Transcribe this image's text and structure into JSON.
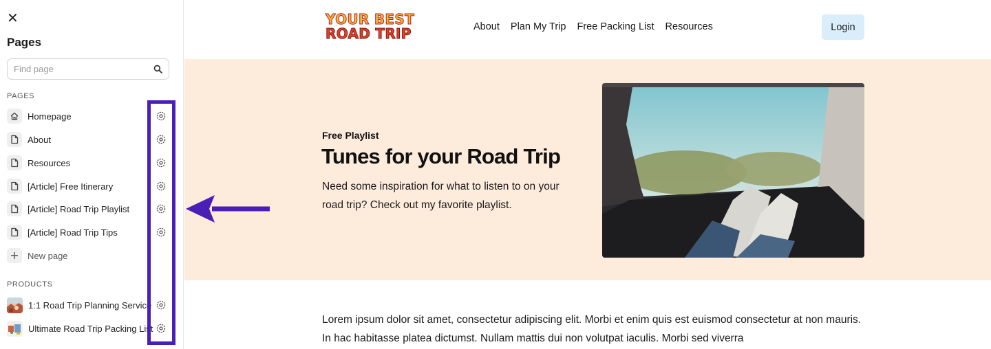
{
  "sidebar": {
    "close_glyph": "✕",
    "title": "Pages",
    "search": {
      "placeholder": "Find page",
      "value": ""
    },
    "pages_section_label": "PAGES",
    "pages": [
      {
        "label": "Homepage",
        "icon": "home-icon"
      },
      {
        "label": "About",
        "icon": "page-icon"
      },
      {
        "label": "Resources",
        "icon": "page-icon"
      },
      {
        "label": "[Article] Free Itinerary",
        "icon": "page-icon"
      },
      {
        "label": "[Article] Road Trip Playlist",
        "icon": "page-icon"
      },
      {
        "label": "[Article] Road Trip Tips",
        "icon": "page-icon"
      }
    ],
    "new_page_label": "New page",
    "products_section_label": "PRODUCTS",
    "products": [
      {
        "label": "1:1 Road Trip Planning Service",
        "icon": "product-thumbnail"
      },
      {
        "label": "Ultimate Road Trip Packing List",
        "icon": "product-thumbnail"
      }
    ]
  },
  "header": {
    "logo_line1": "YOUR BEST",
    "logo_line2": "ROAD TRIP",
    "nav": [
      "About",
      "Plan My Trip",
      "Free Packing List",
      "Resources"
    ],
    "login_label": "Login"
  },
  "hero": {
    "eyebrow": "Free Playlist",
    "title": "Tunes for your Road Trip",
    "text": "Need some inspiration for what to listen to on your road trip? Check out my favorite playlist."
  },
  "body_text": "Lorem ipsum dolor sit amet, consectetur adipiscing elit. Morbi et enim quis est euismod consectetur at non mauris. In hac habitasse platea dictumst. Nullam mattis dui non volutpat iaculis. Morbi sed viverra",
  "colors": {
    "accent_purple": "#4a1fb8",
    "hero_bg": "#fdebdc",
    "login_bg": "#d9edfb",
    "logo_yellow": "#f4b73a",
    "logo_red": "#e7412c"
  }
}
